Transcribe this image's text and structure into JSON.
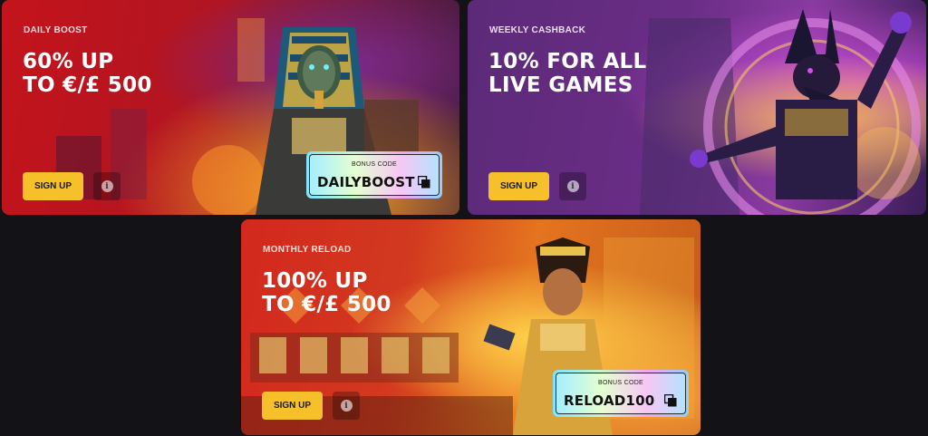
{
  "cards": [
    {
      "label": "DAILY BOOST",
      "headline": [
        "60% UP",
        "TO €/£ 500"
      ],
      "signup": "SIGN UP",
      "info_icon": "info-icon",
      "bonus": {
        "label": "BONUS CODE",
        "code": "DAILYBOOST"
      }
    },
    {
      "label": "WEEKLY CASHBACK",
      "headline": [
        "10% FOR ALL",
        "LIVE GAMES"
      ],
      "signup": "SIGN UP",
      "info_icon": "info-icon"
    },
    {
      "label": "MONTHLY RELOAD",
      "headline": [
        "100% UP",
        "TO €/£ 500"
      ],
      "signup": "SIGN UP",
      "info_icon": "info-icon",
      "bonus": {
        "label": "BONUS CODE",
        "code": "RELOAD100"
      }
    }
  ],
  "colors": {
    "page_bg": "#131217",
    "signup_button": "#f6c02a",
    "daily_card": "#c4141c",
    "weekly_card": "#6a2d86",
    "monthly_card": "#d3281e"
  }
}
